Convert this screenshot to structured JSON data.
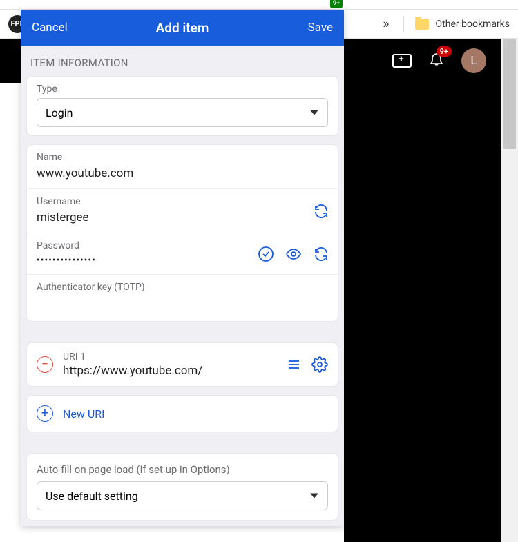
{
  "browser": {
    "ext_badge": "9+",
    "more_glyph": "»",
    "other_bookmarks": "Other bookmarks",
    "fpl_label": "FPL"
  },
  "youtube_bar": {
    "notif_count": "9+",
    "avatar_letter": "L"
  },
  "popup": {
    "cancel": "Cancel",
    "title": "Add item",
    "save": "Save",
    "section_title": "ITEM INFORMATION",
    "type_label": "Type",
    "type_value": "Login",
    "name_label": "Name",
    "name_value": "www.youtube.com",
    "username_label": "Username",
    "username_value": "mistergee",
    "password_label": "Password",
    "password_masked": "•••••••••••••••",
    "totp_label": "Authenticator key (TOTP)",
    "uri1_label": "URI 1",
    "uri1_value": "https://www.youtube.com/",
    "new_uri": "New URI",
    "autofill_label": "Auto-fill on page load (if set up in Options)",
    "autofill_value": "Use default setting"
  }
}
